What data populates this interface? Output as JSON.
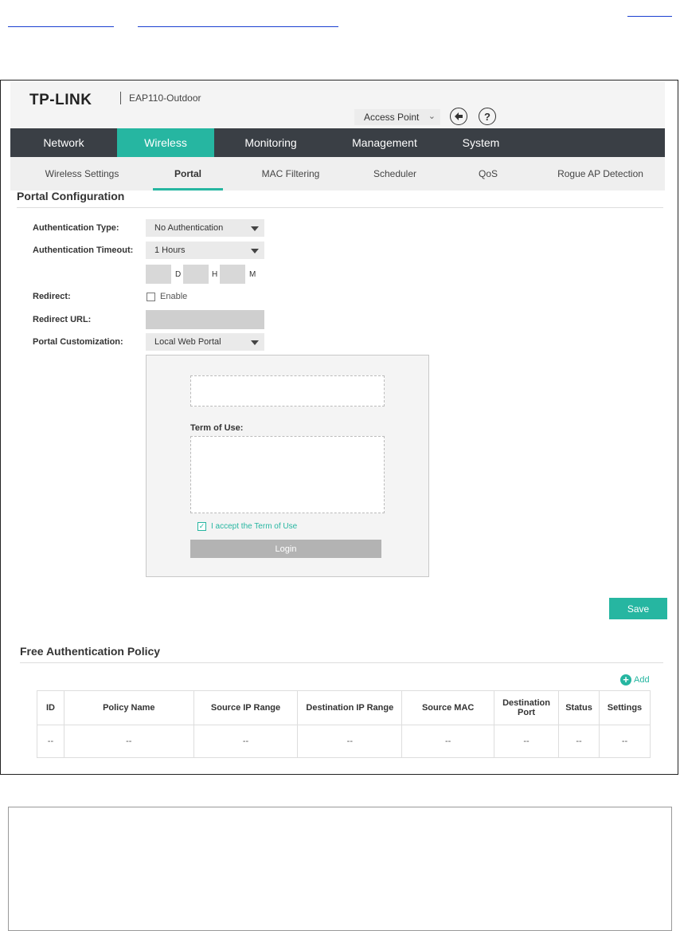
{
  "header": {
    "logo": "TP-LINK",
    "model": "EAP110-Outdoor",
    "mode": "Access Point",
    "mode_chevron": "⌄",
    "icons": [
      "logout-icon",
      "help-icon"
    ]
  },
  "main_nav": [
    "Network",
    "Wireless",
    "Monitoring",
    "Management",
    "System"
  ],
  "sub_nav": [
    "Wireless Settings",
    "Portal",
    "MAC Filtering",
    "Scheduler",
    "QoS",
    "Rogue AP Detection"
  ],
  "portal": {
    "title": "Portal Configuration",
    "auth_type_label": "Authentication Type:",
    "auth_type_value": "No Authentication",
    "auth_timeout_label": "Authentication Timeout:",
    "auth_timeout_value": "1 Hours",
    "unit_d": "D",
    "unit_h": "H",
    "unit_m": "M",
    "redirect_label": "Redirect:",
    "redirect_enable": "Enable",
    "redirect_url_label": "Redirect URL:",
    "customization_label": "Portal Customization:",
    "customization_value": "Local Web Portal",
    "preview": {
      "term_label": "Term of Use:",
      "accept_label": "I accept the Term of Use",
      "login": "Login"
    },
    "save": "Save"
  },
  "policy": {
    "title": "Free Authentication Policy",
    "add": "Add",
    "columns": [
      "ID",
      "Policy Name",
      "Source IP Range",
      "Destination IP Range",
      "Source MAC",
      "Destination Port",
      "Status",
      "Settings"
    ],
    "rows": [
      [
        "--",
        "--",
        "--",
        "--",
        "--",
        "--",
        "--",
        "--"
      ]
    ]
  },
  "colors": {
    "accent": "#26b6a1",
    "nav_dark": "#3a3f45"
  }
}
